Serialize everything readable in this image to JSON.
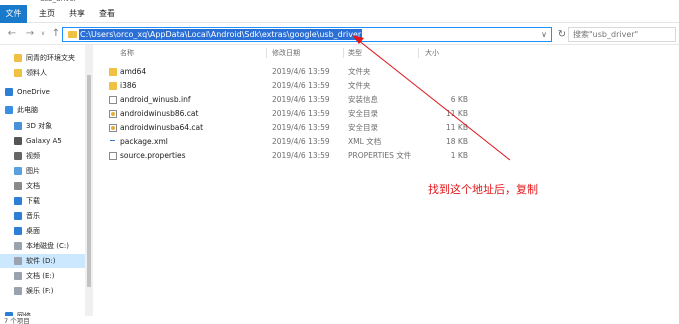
{
  "window": {
    "title": "usb_driver"
  },
  "ribbon": {
    "tabs": [
      "文件",
      "主页",
      "共享",
      "查看"
    ]
  },
  "nav": {
    "back": "←",
    "forward": "→",
    "recent": "∨",
    "up": "↑",
    "path": "C:\\Users\\orco_xq\\AppData\\Local\\Android\\Sdk\\extras\\google\\usb_driver",
    "dropdown": "∨",
    "refresh": "↻",
    "search_placeholder": "搜索\"usb_driver\""
  },
  "sidebar": {
    "items": [
      {
        "label": "同青的环境文夹",
        "icon": "folder-icon"
      },
      {
        "label": "领料人",
        "icon": "folder-icon"
      },
      {
        "label": "OneDrive",
        "icon": "onedrive-icon"
      },
      {
        "label": "此电脑",
        "icon": "this-pc-icon"
      },
      {
        "label": "3D 对象",
        "icon": "3d-objects-icon"
      },
      {
        "label": "Galaxy A5",
        "icon": "phone-icon"
      },
      {
        "label": "视频",
        "icon": "video-icon"
      },
      {
        "label": "图片",
        "icon": "pictures-icon"
      },
      {
        "label": "文档",
        "icon": "documents-icon"
      },
      {
        "label": "下载",
        "icon": "downloads-icon"
      },
      {
        "label": "音乐",
        "icon": "music-icon"
      },
      {
        "label": "桌面",
        "icon": "desktop-icon"
      },
      {
        "label": "本地磁盘 (C:)",
        "icon": "drive-icon"
      },
      {
        "label": "软件 (D:)",
        "icon": "drive-icon"
      },
      {
        "label": "文档 (E:)",
        "icon": "drive-icon"
      },
      {
        "label": "娱乐 (F:)",
        "icon": "drive-icon"
      },
      {
        "label": "网络",
        "icon": "network-icon"
      }
    ],
    "selected_index": 13
  },
  "columns": {
    "name": "名称",
    "date": "修改日期",
    "type": "类型",
    "size": "大小"
  },
  "files": [
    {
      "name": "amd64",
      "date": "2019/4/6 13:59",
      "type": "文件夹",
      "size": "",
      "icon": "folder"
    },
    {
      "name": "i386",
      "date": "2019/4/6 13:59",
      "type": "文件夹",
      "size": "",
      "icon": "folder"
    },
    {
      "name": "android_winusb.inf",
      "date": "2019/4/6 13:59",
      "type": "安装信息",
      "size": "6 KB",
      "icon": "inf"
    },
    {
      "name": "androidwinusb86.cat",
      "date": "2019/4/6 13:59",
      "type": "安全目录",
      "size": "11 KB",
      "icon": "cat"
    },
    {
      "name": "androidwinusba64.cat",
      "date": "2019/4/6 13:59",
      "type": "安全目录",
      "size": "11 KB",
      "icon": "cat"
    },
    {
      "name": "package.xml",
      "date": "2019/4/6 13:59",
      "type": "XML 文档",
      "size": "18 KB",
      "icon": "xml"
    },
    {
      "name": "source.properties",
      "date": "2019/4/6 13:59",
      "type": "PROPERTIES 文件",
      "size": "1 KB",
      "icon": "file"
    }
  ],
  "annotation": {
    "text": "找到这个地址后，复制",
    "color": "#e0161b"
  },
  "status": {
    "count": "7 个项目"
  }
}
